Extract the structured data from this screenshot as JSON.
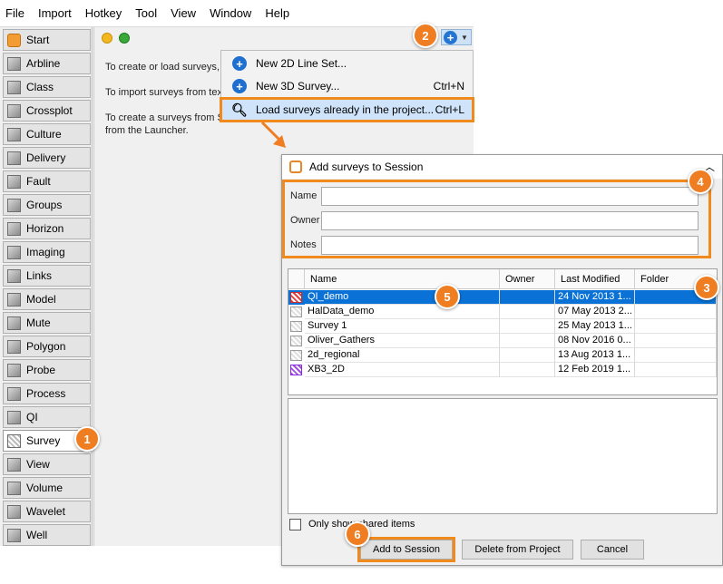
{
  "menubar": {
    "items": [
      "File",
      "Import",
      "Hotkey",
      "Tool",
      "View",
      "Window",
      "Help"
    ]
  },
  "sidebar": {
    "items": [
      {
        "label": "Start",
        "icon": "start-icon"
      },
      {
        "label": "Arbline",
        "icon": "arbline-icon"
      },
      {
        "label": "Class",
        "icon": "class-icon"
      },
      {
        "label": "Crossplot",
        "icon": "crossplot-icon"
      },
      {
        "label": "Culture",
        "icon": "culture-icon"
      },
      {
        "label": "Delivery",
        "icon": "delivery-icon"
      },
      {
        "label": "Fault",
        "icon": "fault-icon"
      },
      {
        "label": "Groups",
        "icon": "groups-icon"
      },
      {
        "label": "Horizon",
        "icon": "horizon-icon"
      },
      {
        "label": "Imaging",
        "icon": "imaging-icon"
      },
      {
        "label": "Links",
        "icon": "links-icon"
      },
      {
        "label": "Model",
        "icon": "model-icon"
      },
      {
        "label": "Mute",
        "icon": "mute-icon"
      },
      {
        "label": "Polygon",
        "icon": "polygon-icon"
      },
      {
        "label": "Probe",
        "icon": "probe-icon"
      },
      {
        "label": "Process",
        "icon": "process-icon"
      },
      {
        "label": "QI",
        "icon": "qi-icon"
      },
      {
        "label": "Survey",
        "icon": "survey-icon"
      },
      {
        "label": "View",
        "icon": "view-icon"
      },
      {
        "label": "Volume",
        "icon": "volume-icon"
      },
      {
        "label": "Wavelet",
        "icon": "wavelet-icon"
      },
      {
        "label": "Well",
        "icon": "well-icon"
      }
    ]
  },
  "main": {
    "lines": [
      "To create or load surveys,",
      "To import surveys from tex",
      "To create a surveys from S",
      "from the Launcher."
    ]
  },
  "dropdown": {
    "items": [
      {
        "label": "New 2D Line Set...",
        "shortcut": ""
      },
      {
        "label": "New 3D Survey...",
        "shortcut": "Ctrl+N"
      },
      {
        "label": "Load surveys already in the project...",
        "shortcut": "Ctrl+L"
      }
    ]
  },
  "dialog": {
    "title": "Add surveys to Session",
    "form": {
      "name_label": "Name",
      "owner_label": "Owner",
      "notes_label": "Notes"
    },
    "table": {
      "headers": [
        "Name",
        "Owner",
        "Last Modified",
        "Folder"
      ],
      "rows": [
        {
          "name": "QI_demo",
          "owner": "",
          "modified": "24 Nov 2013 1...",
          "folder": "",
          "icon": "survey-3d-red-icon"
        },
        {
          "name": "HalData_demo",
          "owner": "",
          "modified": "07 May 2013 2...",
          "folder": "",
          "icon": "survey-3d-icon"
        },
        {
          "name": "Survey 1",
          "owner": "",
          "modified": "25 May 2013 1...",
          "folder": "",
          "icon": "survey-3d-icon"
        },
        {
          "name": "Oliver_Gathers",
          "owner": "",
          "modified": "08 Nov 2016 0...",
          "folder": "",
          "icon": "survey-3d-icon"
        },
        {
          "name": "2d_regional",
          "owner": "",
          "modified": "13 Aug 2013 1...",
          "folder": "",
          "icon": "survey-2d-icon"
        },
        {
          "name": "XB3_2D",
          "owner": "",
          "modified": "12 Feb 2019 1...",
          "folder": "",
          "icon": "survey-2d-purple-icon"
        }
      ]
    },
    "checkbox_label": "Only show shared items",
    "buttons": {
      "add": "Add to Session",
      "delete": "Delete from Project",
      "cancel": "Cancel"
    }
  },
  "callouts": [
    "1",
    "2",
    "3",
    "4",
    "5",
    "6"
  ],
  "colors": {
    "accent": "#f08a1c",
    "selection": "#0a72d6",
    "brand_icon": "#2474d2"
  }
}
